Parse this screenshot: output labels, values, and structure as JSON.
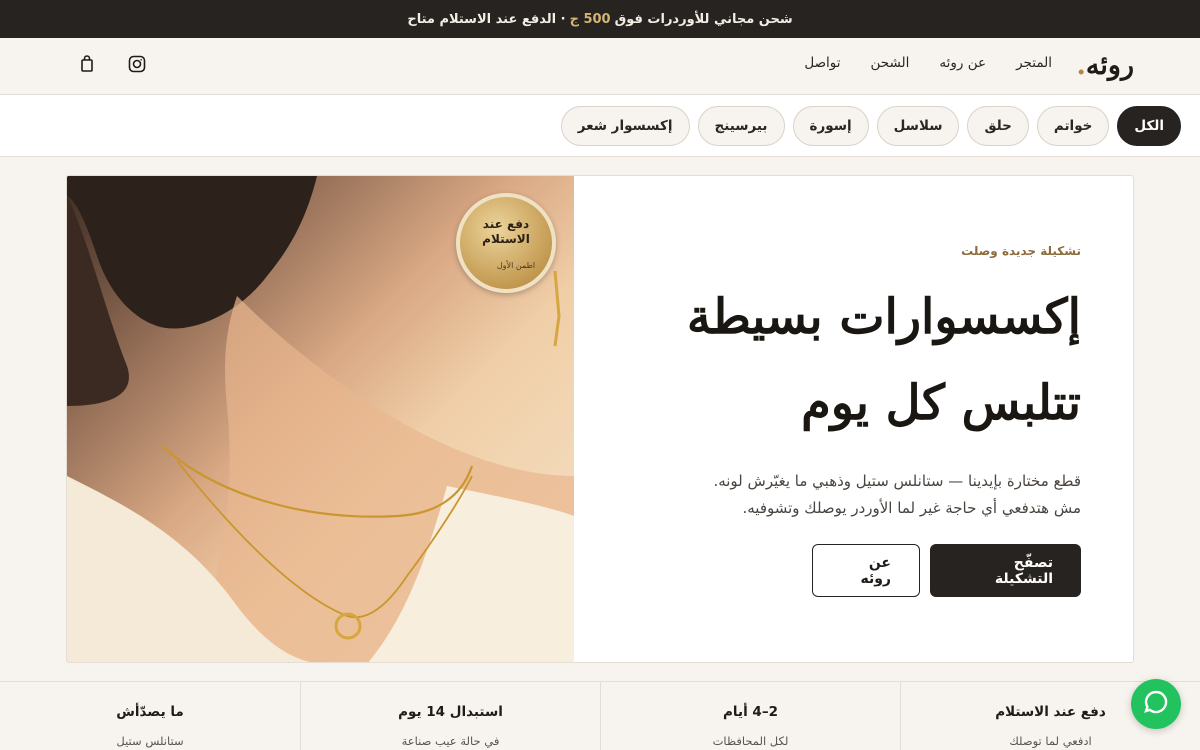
{
  "announcement": {
    "part1": "شحن مجاني للأوردرات فوق",
    "amount": "500 ج",
    "part2": "· الدفع عند الاستلام متاح"
  },
  "header": {
    "logo": "روئه",
    "nav": [
      "المتجر",
      "عن روئه",
      "الشحن",
      "تواصل"
    ],
    "icons": [
      "instagram-icon",
      "shopping-bag-icon"
    ]
  },
  "categories": {
    "active": "الكل",
    "items": [
      "الكل",
      "خواتم",
      "حلق",
      "سلاسل",
      "إسورة",
      "بيرسينج",
      "إكسسوار شعر"
    ]
  },
  "hero": {
    "badge_title": "دفع عند الاستلام",
    "badge_sub": "اطمن الأول",
    "eyebrow": "تشكيلة جديدة وصلت",
    "headline_line1": "إكسسوارات بسيطة",
    "headline_line2": "تتلبس كل يوم",
    "desc_line1": "قطع مختارة بإيدينا — ستانلس ستيل وذهبي ما يغيّرش لونه.",
    "desc_line2": "مش هتدفعي أي حاجة غير لما الأوردر يوصلك وتشوفيه.",
    "cta_primary": "تصفّح التشكيلة",
    "cta_secondary": "عن روئه"
  },
  "features": [
    {
      "title": "دفع عند الاستلام",
      "sub": "ادفعي لما توصلك"
    },
    {
      "title": "2–4 أيام",
      "sub": "لكل المحافظات"
    },
    {
      "title": "استبدال 14 يوم",
      "sub": "في حالة عيب صناعة"
    },
    {
      "title": "ما يصدّأش",
      "sub": "ستانلس ستيل"
    }
  ],
  "colors": {
    "dark": "#262320",
    "gold": "#d4b574",
    "background": "#f7f3ee",
    "chat": "#22c35e"
  }
}
